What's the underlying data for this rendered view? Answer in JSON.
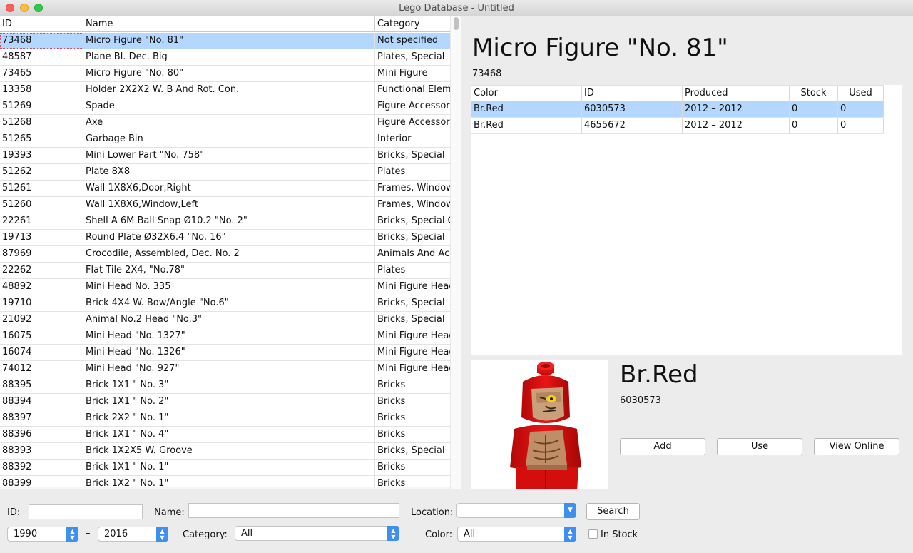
{
  "window": {
    "title": "Lego Database - Untitled"
  },
  "parts_table": {
    "columns": {
      "id": "ID",
      "name": "Name",
      "category": "Category"
    },
    "rows": [
      {
        "id": "73468",
        "name": "Micro Figure \"No. 81\"",
        "category": "Not specified"
      },
      {
        "id": "48587",
        "name": "Plane Bl. Dec. Big",
        "category": "Plates, Special"
      },
      {
        "id": "73465",
        "name": "Micro Figure \"No. 80\"",
        "category": "Mini Figure"
      },
      {
        "id": "13358",
        "name": "Holder 2X2X2 W. B And Rot. Con.",
        "category": "Functional Eleme"
      },
      {
        "id": "51269",
        "name": "Spade",
        "category": "Figure Accessori"
      },
      {
        "id": "51268",
        "name": "Axe",
        "category": "Figure Accessori"
      },
      {
        "id": "51265",
        "name": "Garbage Bin",
        "category": "Interior"
      },
      {
        "id": "19393",
        "name": "Mini Lower Part \"No. 758\"",
        "category": "Bricks, Special"
      },
      {
        "id": "51262",
        "name": "Plate 8X8",
        "category": "Plates"
      },
      {
        "id": "51261",
        "name": "Wall 1X8X6,Door,Right",
        "category": "Frames, Window"
      },
      {
        "id": "51260",
        "name": "Wall 1X8X6,Window,Left",
        "category": "Frames, Window"
      },
      {
        "id": "22261",
        "name": "Shell A 6M Ball Snap Ø10.2 \"No. 2\"",
        "category": "Bricks, Special C"
      },
      {
        "id": "19713",
        "name": "Round Plate Ø32X6.4 \"No. 16\"",
        "category": "Bricks, Special"
      },
      {
        "id": "87969",
        "name": "Crocodile, Assembled, Dec. No. 2",
        "category": "Animals And Acc"
      },
      {
        "id": "22262",
        "name": "Flat Tile 2X4, \"No.78\"",
        "category": "Plates"
      },
      {
        "id": "48892",
        "name": "Mini Head No. 335",
        "category": "Mini Figure Head"
      },
      {
        "id": "19710",
        "name": "Brick 4X4 W. Bow/Angle \"No.6\"",
        "category": "Bricks, Special"
      },
      {
        "id": "21092",
        "name": "Animal No.2 Head \"No.3\"",
        "category": "Bricks, Special"
      },
      {
        "id": "16075",
        "name": "Mini Head \"No. 1327\"",
        "category": "Mini Figure Head"
      },
      {
        "id": "16074",
        "name": "Mini Head \"No. 1326\"",
        "category": "Mini Figure Head"
      },
      {
        "id": "74012",
        "name": "Mini Head \"No. 927\"",
        "category": "Mini Figure Head"
      },
      {
        "id": "88395",
        "name": "Brick 1X1 \" No. 3\"",
        "category": "Bricks"
      },
      {
        "id": "88394",
        "name": "Brick 1X1 \" No. 2\"",
        "category": "Bricks"
      },
      {
        "id": "88397",
        "name": "Brick 2X2 \" No. 1\"",
        "category": "Bricks"
      },
      {
        "id": "88396",
        "name": "Brick 1X1 \" No. 4\"",
        "category": "Bricks"
      },
      {
        "id": "88393",
        "name": "Brick 1X2X5 W. Groove",
        "category": "Bricks, Special"
      },
      {
        "id": "88392",
        "name": "Brick 1X1 \" No. 1\"",
        "category": "Bricks"
      },
      {
        "id": "88399",
        "name": "Brick 1X2 \" No. 1\"",
        "category": "Bricks"
      }
    ]
  },
  "detail": {
    "title": "Micro Figure \"No. 81\"",
    "id": "73468",
    "columns": {
      "color": "Color",
      "id": "ID",
      "produced": "Produced",
      "stock": "Stock",
      "used": "Used"
    },
    "rows": [
      {
        "color": "Br.Red",
        "id": "6030573",
        "produced": "2012 – 2012",
        "stock": "0",
        "used": "0"
      },
      {
        "color": "Br.Red",
        "id": "4655672",
        "produced": "2012 – 2012",
        "stock": "0",
        "used": "0"
      }
    ],
    "variant": {
      "color": "Br.Red",
      "id": "6030573",
      "image_icon": "micro-figure-red-image",
      "buttons": {
        "add": "Add",
        "use": "Use",
        "view_online": "View Online"
      }
    }
  },
  "filters": {
    "id_label": "ID:",
    "id_value": "",
    "name_label": "Name:",
    "name_value": "",
    "location_label": "Location:",
    "location_value": "",
    "search_label": "Search",
    "year_from": "1990",
    "year_separator": "–",
    "year_to": "2016",
    "category_label": "Category:",
    "category_value": "All",
    "color_label": "Color:",
    "color_value": "All",
    "in_stock_label": "In Stock"
  },
  "colors": {
    "selection": "#b3d7ff",
    "accent": "#3d8ff0",
    "figure_red": "#d80f0f"
  }
}
